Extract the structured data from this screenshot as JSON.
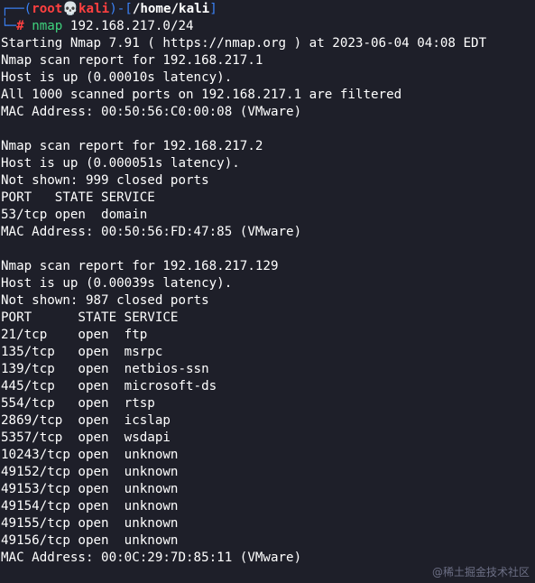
{
  "prompt": {
    "box_top_left": "┌──(",
    "user": "root",
    "skull": "💀",
    "host": "kali",
    "box_mid": ")-[",
    "path": "/home/kali",
    "box_close": "]",
    "box_bottom_left": "└─",
    "hash": "#",
    "command": "nmap",
    "argument": " 192.168.217.0/24"
  },
  "lines": [
    "Starting Nmap 7.91 ( https://nmap.org ) at 2023-06-04 04:08 EDT",
    "Nmap scan report for 192.168.217.1",
    "Host is up (0.00010s latency).",
    "All 1000 scanned ports on 192.168.217.1 are filtered",
    "MAC Address: 00:50:56:C0:00:08 (VMware)",
    "",
    "Nmap scan report for 192.168.217.2",
    "Host is up (0.000051s latency).",
    "Not shown: 999 closed ports",
    "PORT   STATE SERVICE",
    "53/tcp open  domain",
    "MAC Address: 00:50:56:FD:47:85 (VMware)",
    "",
    "Nmap scan report for 192.168.217.129",
    "Host is up (0.00039s latency).",
    "Not shown: 987 closed ports",
    "PORT      STATE SERVICE",
    "21/tcp    open  ftp",
    "135/tcp   open  msrpc",
    "139/tcp   open  netbios-ssn",
    "445/tcp   open  microsoft-ds",
    "554/tcp   open  rtsp",
    "2869/tcp  open  icslap",
    "5357/tcp  open  wsdapi",
    "10243/tcp open  unknown",
    "49152/tcp open  unknown",
    "49153/tcp open  unknown",
    "49154/tcp open  unknown",
    "49155/tcp open  unknown",
    "49156/tcp open  unknown",
    "MAC Address: 00:0C:29:7D:85:11 (VMware)"
  ],
  "watermark": "@稀土掘金技术社区",
  "colors": {
    "background": "#1e1f29",
    "prompt_frame": "#3b82f6",
    "prompt_user_host": "#ff4040",
    "command": "#3fd27d",
    "output_text": "#ffffff"
  }
}
